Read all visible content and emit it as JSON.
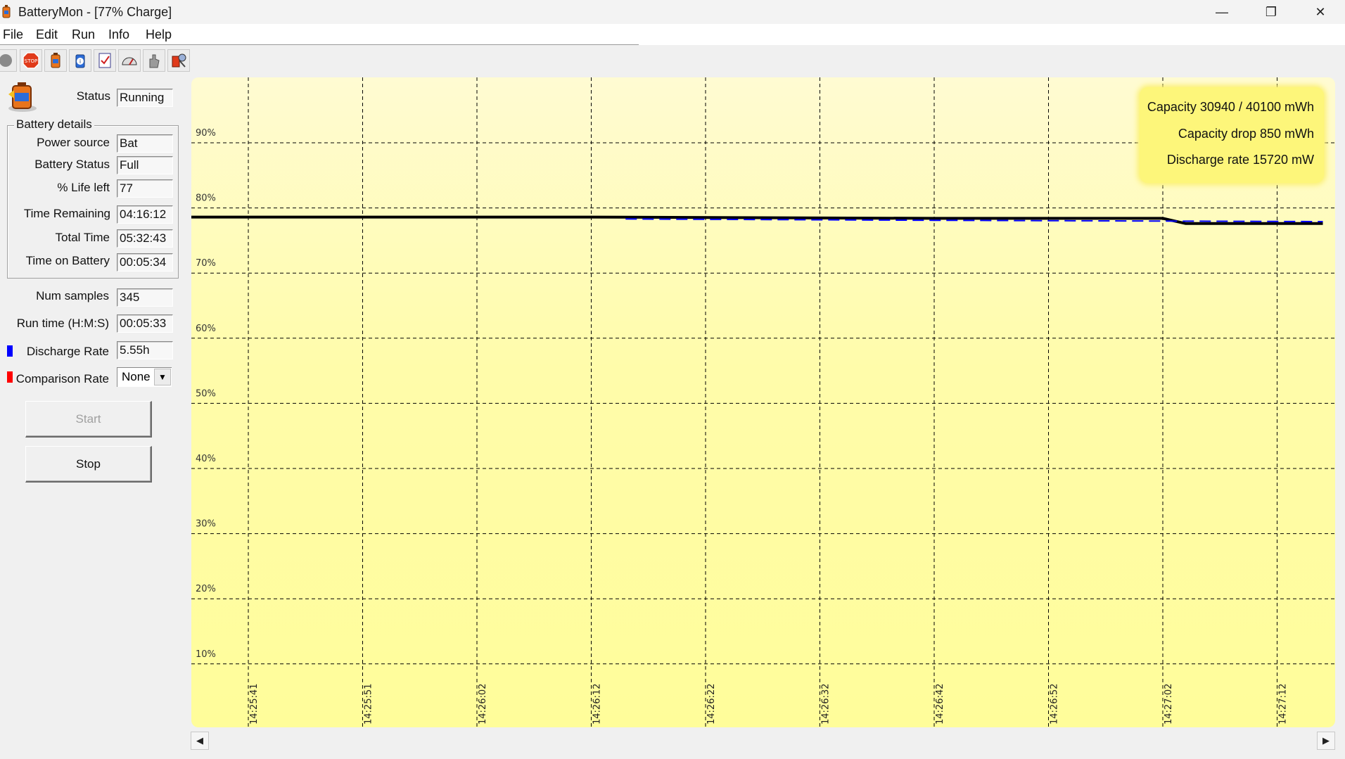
{
  "window": {
    "title": "BatteryMon - [77% Charge]",
    "controls": {
      "minimize": "—",
      "restore": "❐",
      "close": "✕"
    }
  },
  "menu": [
    "File",
    "Edit",
    "Run",
    "Info",
    "Help"
  ],
  "toolbar": {
    "icons": [
      "start-icon",
      "stop-icon",
      "battery-icon",
      "battery-info-icon",
      "checklist-icon",
      "gauge-icon",
      "hand-icon",
      "tools-icon"
    ]
  },
  "status": {
    "label": "Status",
    "value": "Running"
  },
  "battery_details": {
    "title": "Battery details",
    "rows": [
      {
        "label": "Power source",
        "value": "Bat"
      },
      {
        "label": "Battery Status",
        "value": "Full"
      },
      {
        "label": "% Life left",
        "value": "77"
      },
      {
        "label": "Time Remaining",
        "value": "04:16:12"
      },
      {
        "label": "Total Time",
        "value": "05:32:43"
      },
      {
        "label": "Time on Battery",
        "value": "00:05:34"
      }
    ]
  },
  "stats": {
    "num_samples": {
      "label": "Num samples",
      "value": "345"
    },
    "run_time": {
      "label": "Run time (H:M:S)",
      "value": "00:05:33"
    },
    "discharge_rate": {
      "label": "Discharge Rate",
      "value": "5.55h",
      "color": "#0000ff"
    },
    "comparison_rate": {
      "label": "Comparison Rate",
      "value": "None",
      "color": "#ff0000"
    }
  },
  "buttons": {
    "start": "Start",
    "stop": "Stop"
  },
  "info_box": {
    "capacity": "Capacity 30940 / 40100 mWh",
    "capacity_drop": "Capacity drop 850 mWh",
    "discharge_rate": "Discharge rate 15720 mW"
  },
  "colors": {
    "chart_bg_top": "#fffbd2",
    "chart_bg_bottom": "#fffd9a",
    "charge_line": "#000000",
    "discharge_line": "#0000ff",
    "grid": "#000000"
  },
  "chart_data": {
    "type": "line",
    "title": "",
    "xlabel": "",
    "ylabel": "",
    "ylim": [
      0,
      100
    ],
    "y_ticks": [
      "90%",
      "80%",
      "70%",
      "60%",
      "50%",
      "40%",
      "30%",
      "20%",
      "10%"
    ],
    "y_tick_values": [
      90,
      80,
      70,
      60,
      50,
      40,
      30,
      20,
      10
    ],
    "x_ticks": [
      "14:25:41",
      "14:25:51",
      "14:26:02",
      "14:26:12",
      "14:26:22",
      "14:26:32",
      "14:26:42",
      "14:26:52",
      "14:27:02",
      "14:27:12"
    ],
    "grid": true,
    "series": [
      {
        "style": "solid",
        "x": [
          "14:25:36",
          "14:26:12",
          "14:26:42",
          "14:27:02",
          "14:27:04",
          "14:27:16"
        ],
        "y": [
          78.6,
          78.6,
          78.4,
          78.4,
          77.6,
          77.6
        ]
      },
      {
        "style": "dashed",
        "x": [
          "14:26:15",
          "14:26:42",
          "14:27:16"
        ],
        "y": [
          78.3,
          78.1,
          77.9
        ]
      }
    ]
  }
}
